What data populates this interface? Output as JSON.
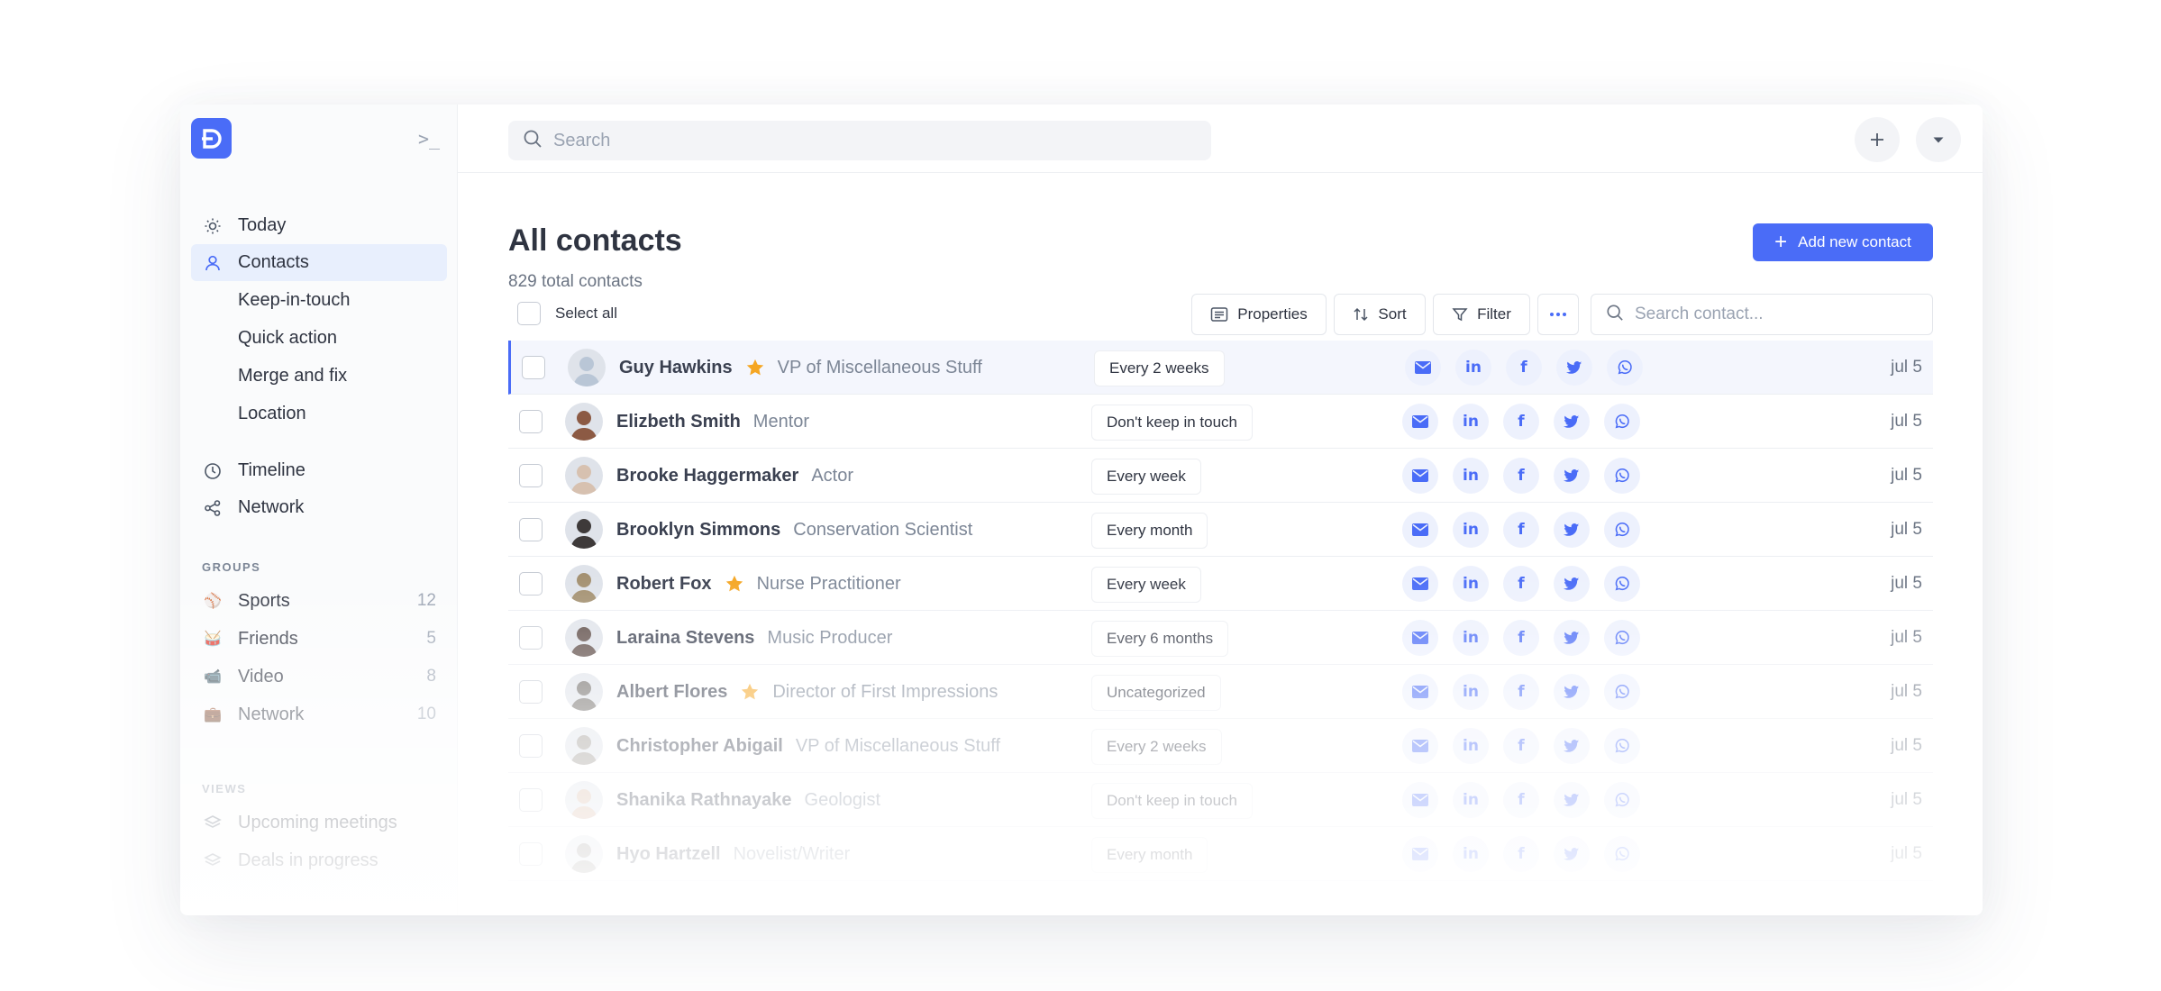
{
  "sidebar": {
    "nav": [
      {
        "label": "Today",
        "icon": "sun-icon"
      },
      {
        "label": "Contacts",
        "icon": "user-icon",
        "active": true
      }
    ],
    "sub_items": [
      "Keep-in-touch",
      "Quick action",
      "Merge and fix",
      "Location"
    ],
    "nav2": [
      {
        "label": "Timeline",
        "icon": "clock-icon"
      },
      {
        "label": "Network",
        "icon": "share-icon"
      }
    ],
    "groups_label": "GROUPS",
    "groups": [
      {
        "label": "Sports",
        "count": "12",
        "emoji": "⚾"
      },
      {
        "label": "Friends",
        "count": "5",
        "emoji": "🥁"
      },
      {
        "label": "Video",
        "count": "8",
        "emoji": "📹"
      },
      {
        "label": "Network",
        "count": "10",
        "emoji": "💼"
      }
    ],
    "views_label": "VIEWS",
    "views": [
      "Upcoming meetings",
      "Deals in progress"
    ]
  },
  "topbar": {
    "search_placeholder": "Search"
  },
  "main": {
    "title": "All contacts",
    "subtitle": "829 total contacts",
    "add_label": "Add new contact",
    "select_all": "Select all",
    "properties_label": "Properties",
    "sort_label": "Sort",
    "filter_label": "Filter",
    "contact_search_placeholder": "Search contact..."
  },
  "contacts": [
    {
      "name": "Guy Hawkins",
      "starred": true,
      "title": "VP of Miscellaneous Stuff",
      "frequency": "Every 2 weeks",
      "date": "jul 5",
      "avatar_color": "#b9c6d6"
    },
    {
      "name": "Elizbeth Smith",
      "starred": false,
      "title": "Mentor",
      "frequency": "Don't keep in touch",
      "date": "jul 5",
      "avatar_color": "#8c5a44"
    },
    {
      "name": "Brooke Haggermaker",
      "starred": false,
      "title": "Actor",
      "frequency": "Every week",
      "date": "jul 5",
      "avatar_color": "#d7c1b0"
    },
    {
      "name": "Brooklyn Simmons",
      "starred": false,
      "title": "Conservation Scientist",
      "frequency": "Every month",
      "date": "jul 5",
      "avatar_color": "#3e3a3a"
    },
    {
      "name": "Robert Fox",
      "starred": true,
      "title": "Nurse Practitioner",
      "frequency": "Every week",
      "date": "jul 5",
      "avatar_color": "#a39070"
    },
    {
      "name": "Laraina Stevens",
      "starred": false,
      "title": "Music Producer",
      "frequency": "Every 6 months",
      "date": "jul 5",
      "avatar_color": "#5b4944"
    },
    {
      "name": "Albert Flores",
      "starred": true,
      "title": "Director of First Impressions",
      "frequency": "Uncategorized",
      "date": "jul 5",
      "avatar_color": "#6e6a66"
    },
    {
      "name": "Christopher Abigail",
      "starred": false,
      "title": "VP of Miscellaneous Stuff",
      "frequency": "Every 2 weeks",
      "date": "jul 5",
      "avatar_color": "#9e9993"
    },
    {
      "name": "Shanika Rathnayake",
      "starred": false,
      "title": "Geologist",
      "frequency": "Don't keep in touch",
      "date": "jul 5",
      "avatar_color": "#d8b8a4"
    },
    {
      "name": "Hyo Hartzell",
      "starred": false,
      "title": "Novelist/Writer",
      "frequency": "Every month",
      "date": "jul 5",
      "avatar_color": "#8e8a86"
    }
  ],
  "social_icons": [
    "mail-icon",
    "linkedin-icon",
    "facebook-icon",
    "twitter-icon",
    "whatsapp-icon"
  ],
  "colors": {
    "accent": "#4a6cf7",
    "star": "#f5a623"
  }
}
